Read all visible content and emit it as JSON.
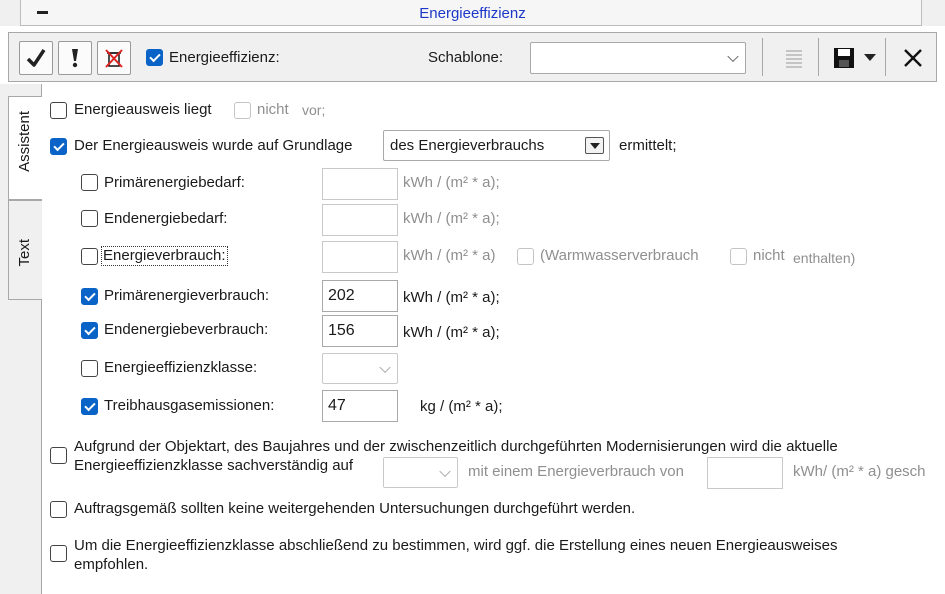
{
  "window": {
    "title": "Energieeffizienz"
  },
  "toolbar": {
    "check_icon": "checkmark-icon",
    "exclaim_icon": "exclamation-icon",
    "delete_icon": "delete-icon",
    "energy_checkbox_label": "Energieeffizienz:",
    "energy_checked": true,
    "schablone_label": "Schablone:",
    "schablone_value": "",
    "list_icon": "list-icon",
    "save_icon": "save-icon",
    "dropdown_icon": "chevron-down-icon",
    "close_icon": "close-icon"
  },
  "tabs": [
    {
      "label": "Assistent",
      "active": true
    },
    {
      "label": "Text",
      "active": false
    }
  ],
  "form": {
    "row1": {
      "label": "Energieausweis liegt",
      "nicht": "nicht",
      "vor": "vor;"
    },
    "row2": {
      "label": "Der Energieausweis wurde auf Grundlage",
      "select_value": "des Energieverbrauchs",
      "suffix": "ermittelt;"
    },
    "fields": [
      {
        "label": "Primärenergiebedarf:",
        "checked": false,
        "value": "",
        "unit": "kWh / (m² * a);",
        "enabled": false
      },
      {
        "label": "Endenergiebedarf:",
        "checked": false,
        "value": "",
        "unit": "kWh / (m² * a);",
        "enabled": false
      },
      {
        "label": "Energieverbrauch:",
        "checked": false,
        "value": "",
        "unit": "kWh / (m² * a)",
        "enabled": false
      },
      {
        "label": "Primärenergieverbrauch:",
        "checked": true,
        "value": "202",
        "unit": "kWh / (m² * a);",
        "enabled": true
      },
      {
        "label": "Endenergiebeverbrauch:",
        "checked": true,
        "value": "156",
        "unit": "kWh / (m² * a);",
        "enabled": true
      },
      {
        "label": "Energieeffizienzklasse:",
        "checked": false,
        "value": "",
        "unit": "",
        "enabled": false
      },
      {
        "label": "Treibhausgasemissionen:",
        "checked": true,
        "value": "47",
        "unit": "kg / (m² * a);",
        "enabled": true
      }
    ],
    "warmwasser": {
      "label": "(Warmwasserverbrauch",
      "nicht": "nicht",
      "enthalten": "enthalten)"
    },
    "para1": {
      "line1": "Aufgrund der Objektart, des Baujahres und der zwischenzeitlich durchgeführten Modernisierungen wird die aktuelle",
      "line2": "Energieeffizienzklasse sachverständig auf",
      "mid": "mit einem Energieverbrauch von",
      "unit": "kWh/ (m² * a) gesch"
    },
    "para2": "Auftragsgemäß sollten keine weitergehenden Untersuchungen durchgeführt werden.",
    "para3": {
      "line1": "Um die Energieeffizienzklasse abschließend zu bestimmen, wird ggf. die Erstellung eines neuen Energieausweises",
      "line2": "empfohlen."
    }
  }
}
